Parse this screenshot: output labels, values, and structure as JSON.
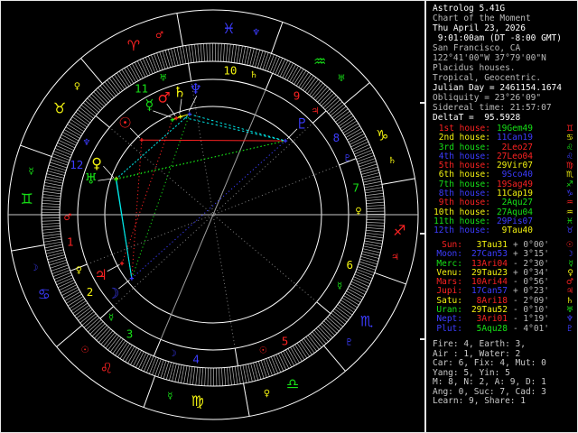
{
  "app": {
    "name": "Astrolog 5.41G"
  },
  "palette": {
    "red": "#fb2222",
    "yellow": "#f4f410",
    "green": "#17e117",
    "blue": "#3c3cff",
    "cyan": "#00e8e8",
    "white": "#ffffff",
    "gray": "#b9b9b9",
    "dgray": "#8a8a8a",
    "tick": "#b4b4b4",
    "frame": "#e8e8e8"
  },
  "header": {
    "lines": [
      {
        "text": "Astrolog 5.41G",
        "tone": "w"
      },
      {
        "text": "Chart of the Moment",
        "tone": "g"
      },
      {
        "text": "Thu April 23, 2026",
        "tone": "w"
      },
      {
        "text": " 9:01:00am (DT -8:00 GMT)",
        "tone": "w"
      },
      {
        "text": "San Francisco, CA",
        "tone": "g"
      },
      {
        "text": "122°41'00\"W 37°79'00\"N",
        "tone": "g"
      },
      {
        "text": "Placidus houses.",
        "tone": "g"
      },
      {
        "text": "Tropical, Geocentric.",
        "tone": "g"
      },
      {
        "text": "Julian Day = 2461154.1674",
        "tone": "w"
      },
      {
        "text": "Obliquity = 23°26'09\"",
        "tone": "g"
      },
      {
        "text": "Sidereal time: 21:57:07",
        "tone": "g"
      },
      {
        "text": "DeltaT =  95.5928",
        "tone": "w"
      }
    ]
  },
  "panel": {
    "houses": [
      {
        "label": "1st house:",
        "value": "19Gem49",
        "value_color": "green",
        "house_color": "red",
        "glyph": "♊",
        "lon": 79.817
      },
      {
        "label": "2nd house:",
        "value": "11Can19",
        "value_color": "blue",
        "house_color": "yellow",
        "glyph": "♋",
        "lon": 101.317
      },
      {
        "label": "3rd house:",
        "value": "2Leo27",
        "value_color": "red",
        "house_color": "green",
        "glyph": "♌",
        "lon": 122.45
      },
      {
        "label": "4th house:",
        "value": "27Leo04",
        "value_color": "red",
        "house_color": "blue",
        "glyph": "♌",
        "lon": 147.067
      },
      {
        "label": "5th house:",
        "value": "29Vir07",
        "value_color": "yellow",
        "house_color": "red",
        "glyph": "♍",
        "lon": 179.117
      },
      {
        "label": "6th house:",
        "value": "9Sco40",
        "value_color": "blue",
        "house_color": "yellow",
        "glyph": "♏",
        "lon": 219.667
      },
      {
        "label": "7th house:",
        "value": "19Sag49",
        "value_color": "red",
        "house_color": "green",
        "glyph": "♐",
        "lon": 259.817
      },
      {
        "label": "8th house:",
        "value": "11Cap19",
        "value_color": "yellow",
        "house_color": "blue",
        "glyph": "♑",
        "lon": 281.317
      },
      {
        "label": "9th house:",
        "value": "2Aqu27",
        "value_color": "green",
        "house_color": "red",
        "glyph": "♒",
        "lon": 302.45
      },
      {
        "label": "10th house:",
        "value": "27Aqu04",
        "value_color": "green",
        "house_color": "yellow",
        "glyph": "♒",
        "lon": 327.067
      },
      {
        "label": "11th house:",
        "value": "29Pis07",
        "value_color": "blue",
        "house_color": "green",
        "glyph": "♓",
        "lon": 359.117
      },
      {
        "label": "12th house:",
        "value": "9Tau40",
        "value_color": "yellow",
        "house_color": "blue",
        "glyph": "♉",
        "lon": 39.667
      }
    ],
    "planets": [
      {
        "label": "Sun:",
        "value": "3Tau31",
        "value_color": "yellow",
        "vel": "+ 0°00'",
        "color": "red",
        "glyph": "☉",
        "lon": 33.517
      },
      {
        "label": "Moon:",
        "value": "27Can53",
        "value_color": "blue",
        "vel": "+ 3°15'",
        "color": "blue",
        "glyph": "☽",
        "lon": 117.883
      },
      {
        "label": "Merc:",
        "value": "13Ari04",
        "value_color": "red",
        "vel": "- 2°30'",
        "color": "green",
        "glyph": "☿",
        "lon": 13.067
      },
      {
        "label": "Venu:",
        "value": "29Tau23",
        "value_color": "yellow",
        "vel": "+ 0°34'",
        "color": "yellow",
        "glyph": "♀",
        "lon": 59.383
      },
      {
        "label": "Mars:",
        "value": "10Ari44",
        "value_color": "red",
        "vel": "- 0°56'",
        "color": "red",
        "glyph": "♂",
        "lon": 10.733
      },
      {
        "label": "Jupi:",
        "value": "17Can57",
        "value_color": "blue",
        "vel": "+ 0°23'",
        "color": "red",
        "glyph": "♃",
        "lon": 107.95
      },
      {
        "label": "Satu:",
        "value": "8Ari18",
        "value_color": "red",
        "vel": "- 2°09'",
        "color": "yellow",
        "glyph": "♄",
        "lon": 8.3
      },
      {
        "label": "Uran:",
        "value": "29Tau52",
        "value_color": "yellow",
        "vel": "- 0°10'",
        "color": "green",
        "glyph": "♅",
        "lon": 59.867
      },
      {
        "label": "Nept:",
        "value": "3Ari01",
        "value_color": "red",
        "vel": "- 1°19'",
        "color": "blue",
        "glyph": "♆",
        "lon": 3.017
      },
      {
        "label": "Plut:",
        "value": "5Aqu28",
        "value_color": "green",
        "vel": "- 4°01'",
        "color": "blue",
        "glyph": "♇",
        "lon": 305.467
      }
    ],
    "stats": {
      "lines": [
        "Fire: 4, Earth: 3,",
        "Air : 1, Water: 2",
        "Car: 6, Fix: 4, Mut: 0",
        "Yang: 5, Yin: 5",
        "M: 8, N: 2, A: 9, D: 1",
        "Ang: 0, Suc: 7, Cad: 3",
        "Learn: 9, Share: 1"
      ]
    }
  },
  "wheel": {
    "ascendant_lon": 79.817,
    "signs": [
      {
        "glyph": "♈",
        "color": "red",
        "ruler": "♂",
        "ruler_color": "red"
      },
      {
        "glyph": "♉",
        "color": "yellow",
        "ruler": "♀",
        "ruler_color": "yellow"
      },
      {
        "glyph": "♊",
        "color": "green",
        "ruler": "☿",
        "ruler_color": "green"
      },
      {
        "glyph": "♋",
        "color": "blue",
        "ruler": "☽",
        "ruler_color": "blue"
      },
      {
        "glyph": "♌",
        "color": "red",
        "ruler": "☉",
        "ruler_color": "red"
      },
      {
        "glyph": "♍",
        "color": "yellow",
        "ruler": "☿",
        "ruler_color": "green"
      },
      {
        "glyph": "♎",
        "color": "green",
        "ruler": "♀",
        "ruler_color": "yellow"
      },
      {
        "glyph": "♏",
        "color": "blue",
        "ruler": "♇",
        "ruler_color": "blue"
      },
      {
        "glyph": "♐",
        "color": "red",
        "ruler": "♃",
        "ruler_color": "red"
      },
      {
        "glyph": "♑",
        "color": "yellow",
        "ruler": "♄",
        "ruler_color": "yellow"
      },
      {
        "glyph": "♒",
        "color": "green",
        "ruler": "♅",
        "ruler_color": "green"
      },
      {
        "glyph": "♓",
        "color": "blue",
        "ruler": "♆",
        "ruler_color": "blue"
      }
    ],
    "house_numbers": [
      "1",
      "2",
      "3",
      "4",
      "5",
      "6",
      "7",
      "8",
      "9",
      "10",
      "11",
      "12"
    ],
    "house_number_colors": [
      "red",
      "yellow",
      "green",
      "blue",
      "red",
      "yellow",
      "green",
      "blue",
      "red",
      "yellow",
      "green",
      "blue"
    ],
    "house_rulers": [
      {
        "glyph": "♂",
        "color": "red"
      },
      {
        "glyph": "♀",
        "color": "yellow"
      },
      {
        "glyph": "☿",
        "color": "green"
      },
      {
        "glyph": "☽",
        "color": "blue"
      },
      {
        "glyph": "☉",
        "color": "red"
      },
      {
        "glyph": "☿",
        "color": "green"
      },
      {
        "glyph": "♀",
        "color": "yellow"
      },
      {
        "glyph": "♇",
        "color": "blue"
      },
      {
        "glyph": "♃",
        "color": "red"
      },
      {
        "glyph": "♄",
        "color": "yellow"
      },
      {
        "glyph": "♅",
        "color": "green"
      },
      {
        "glyph": "♆",
        "color": "blue"
      }
    ],
    "aspects": [
      {
        "a": 2,
        "b": 4,
        "color": "yellow",
        "dash": "solid",
        "name": "Mercury-Mars conjunction"
      },
      {
        "a": 2,
        "b": 6,
        "color": "yellow",
        "dash": "solid",
        "name": "Mercury-Saturn conjunction"
      },
      {
        "a": 4,
        "b": 6,
        "color": "yellow",
        "dash": "solid",
        "name": "Mars-Saturn conjunction"
      },
      {
        "a": 6,
        "b": 8,
        "color": "yellow",
        "dash": "solid",
        "name": "Saturn-Neptune conjunction"
      },
      {
        "a": 0,
        "b": 9,
        "color": "red",
        "dash": "solid",
        "name": "Sun-Pluto square"
      },
      {
        "a": 0,
        "b": 1,
        "color": "red",
        "dash": "dot",
        "name": "Sun-Moon square"
      },
      {
        "a": 2,
        "b": 5,
        "color": "red",
        "dash": "dot",
        "name": "Mercury-Jupiter square"
      },
      {
        "a": 1,
        "b": 3,
        "color": "cyan",
        "dash": "solid",
        "name": "Moon-Venus sextile"
      },
      {
        "a": 1,
        "b": 7,
        "color": "cyan",
        "dash": "solid",
        "name": "Moon-Uranus sextile"
      },
      {
        "a": 6,
        "b": 9,
        "color": "cyan",
        "dash": "med",
        "name": "Saturn-Pluto sextile"
      },
      {
        "a": 8,
        "b": 9,
        "color": "cyan",
        "dash": "med",
        "name": "Neptune-Pluto sextile"
      },
      {
        "a": 3,
        "b": 8,
        "color": "cyan",
        "dash": "dot",
        "name": "Venus-Neptune sextile"
      },
      {
        "a": 7,
        "b": 8,
        "color": "cyan",
        "dash": "dot",
        "name": "Uranus-Neptune sextile"
      },
      {
        "a": 1,
        "b": 8,
        "color": "green",
        "dash": "dot",
        "name": "Moon-Neptune trine"
      },
      {
        "a": 3,
        "b": 9,
        "color": "green",
        "dash": "dot",
        "name": "Venus-Pluto trine"
      },
      {
        "a": 7,
        "b": 9,
        "color": "green",
        "dash": "dot",
        "name": "Uranus-Pluto trine"
      },
      {
        "a": 1,
        "b": 9,
        "color": "blue",
        "dash": "dot",
        "name": "Moon-Pluto opposition"
      }
    ]
  }
}
